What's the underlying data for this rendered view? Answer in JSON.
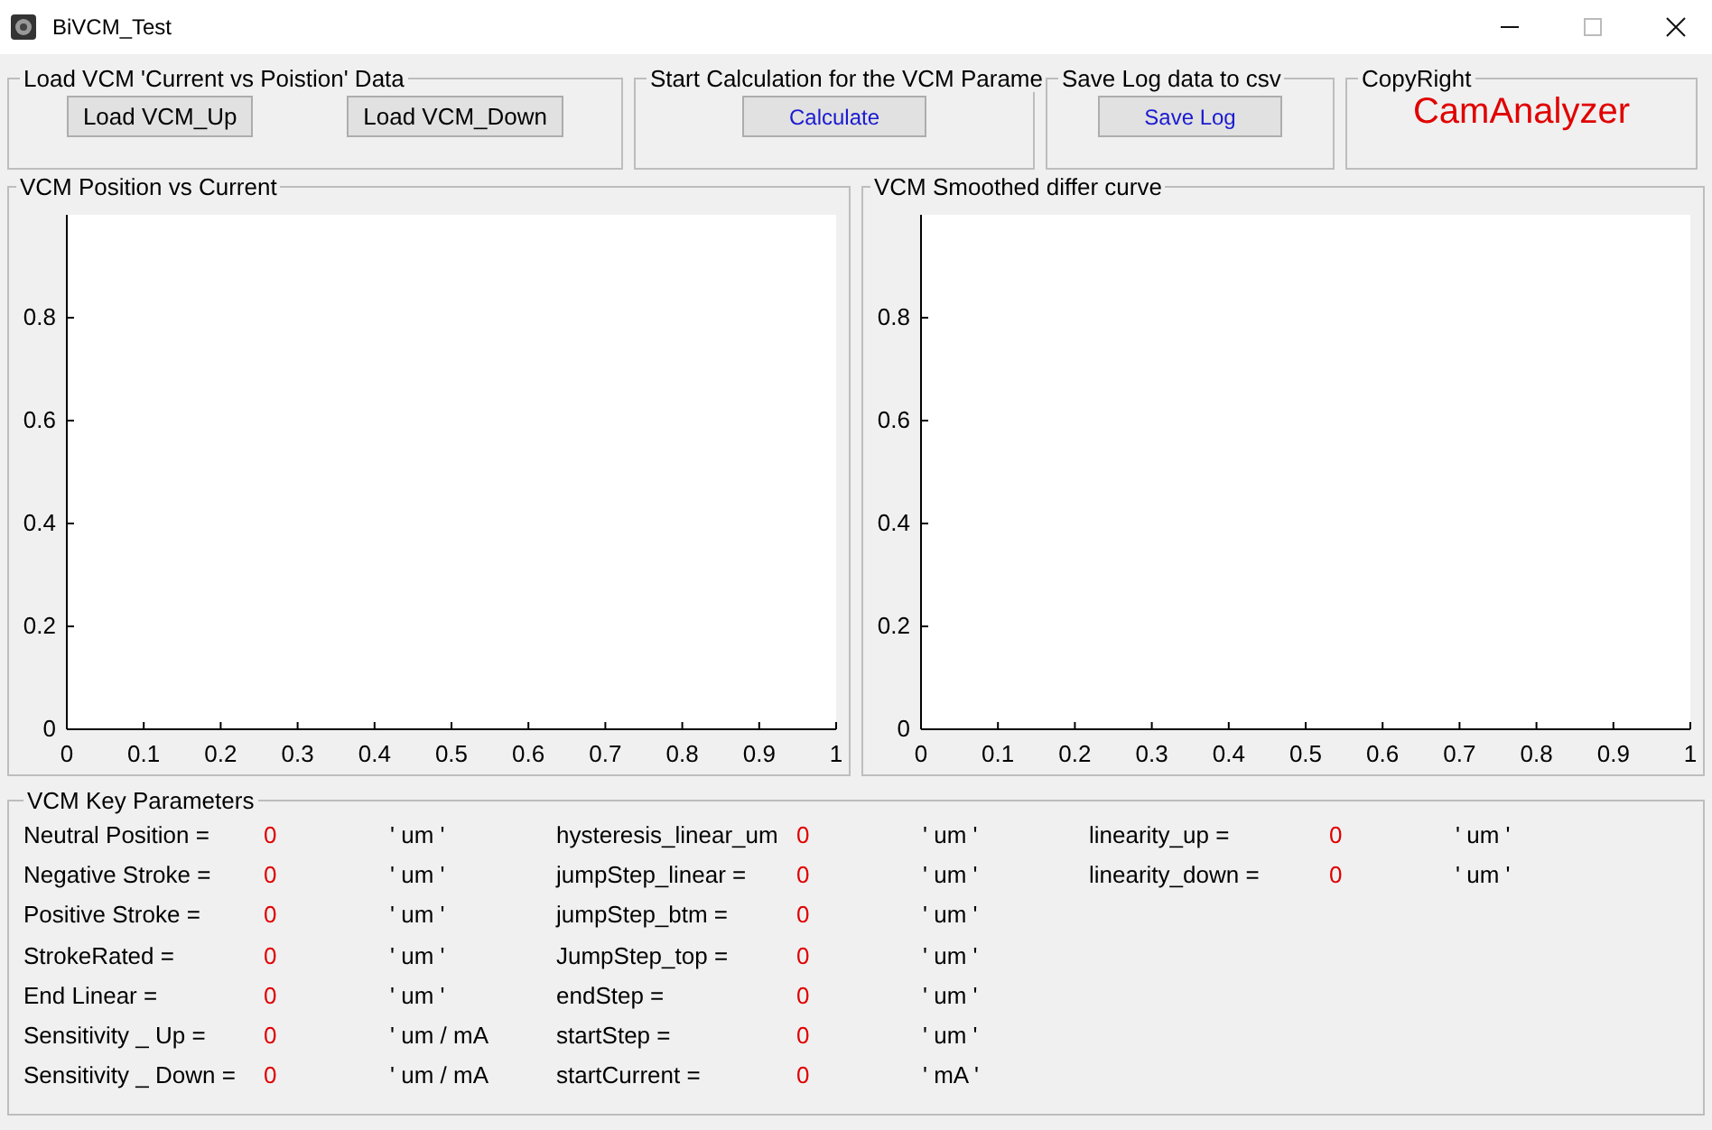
{
  "window": {
    "title": "BiVCM_Test"
  },
  "top_groups": [
    {
      "kind": "buttons",
      "title": "Load VCM 'Current vs Poistion' Data",
      "buttons": [
        "Load VCM_Up",
        "Load VCM_Down"
      ]
    },
    {
      "kind": "action",
      "title": "Start Calculation for the VCM Parame",
      "buttons": [
        "Calculate"
      ]
    },
    {
      "kind": "action",
      "title": "Save Log data to csv",
      "buttons": [
        "Save Log"
      ]
    },
    {
      "kind": "brand",
      "title": "CopyRight",
      "brand": "CamAnalyzer"
    }
  ],
  "charts": [
    {
      "title": "VCM Position vs Current",
      "chart_data": {
        "type": "line",
        "xlim": [
          0,
          1
        ],
        "ylim": [
          0,
          1
        ],
        "xticks": [
          0,
          0.1,
          0.2,
          0.3,
          0.4,
          0.5,
          0.6,
          0.7,
          0.8,
          0.9,
          1
        ],
        "yticks": [
          0,
          0.2,
          0.4,
          0.6,
          0.8
        ]
      }
    },
    {
      "title": "VCM Smoothed differ curve",
      "chart_data": {
        "type": "line",
        "xlim": [
          0,
          1
        ],
        "ylim": [
          0,
          1
        ],
        "xticks": [
          0,
          0.1,
          0.2,
          0.3,
          0.4,
          0.5,
          0.6,
          0.7,
          0.8,
          0.9,
          1
        ],
        "yticks": [
          0,
          0.2,
          0.4,
          0.6,
          0.8
        ]
      }
    }
  ],
  "parameters": {
    "title": "VCM Key Parameters",
    "columns": [
      [
        {
          "label": "Neutral Position =",
          "value": "0",
          "unit": "' um '"
        },
        {
          "label": "Negative Stroke =",
          "value": "0",
          "unit": "' um '"
        },
        {
          "label": "Positive Stroke =",
          "value": "0",
          "unit": "' um '"
        },
        {
          "label": "StrokeRated =",
          "value": "0",
          "unit": "' um '"
        },
        {
          "label": "End Linear =",
          "value": "0",
          "unit": "' um '"
        },
        {
          "label": "Sensitivity _ Up =",
          "value": "0",
          "unit": "' um / mA"
        },
        {
          "label": "Sensitivity _ Down =",
          "value": "0",
          "unit": "' um / mA"
        }
      ],
      [
        {
          "label": "hysteresis_linear_um",
          "value": "0",
          "unit": "' um '"
        },
        {
          "label": "jumpStep_linear =",
          "value": "0",
          "unit": "' um '"
        },
        {
          "label": "jumpStep_btm =",
          "value": "0",
          "unit": "' um '"
        },
        {
          "label": "JumpStep_top =",
          "value": "0",
          "unit": "' um '"
        },
        {
          "label": "endStep =",
          "value": "0",
          "unit": "' um '"
        },
        {
          "label": "startStep =",
          "value": "0",
          "unit": "' um '"
        },
        {
          "label": "startCurrent =",
          "value": "0",
          "unit": "' mA '"
        }
      ],
      [
        {
          "label": "linearity_up =",
          "value": "0",
          "unit": "' um '"
        },
        {
          "label": "linearity_down =",
          "value": "0",
          "unit": "' um '"
        }
      ]
    ]
  }
}
